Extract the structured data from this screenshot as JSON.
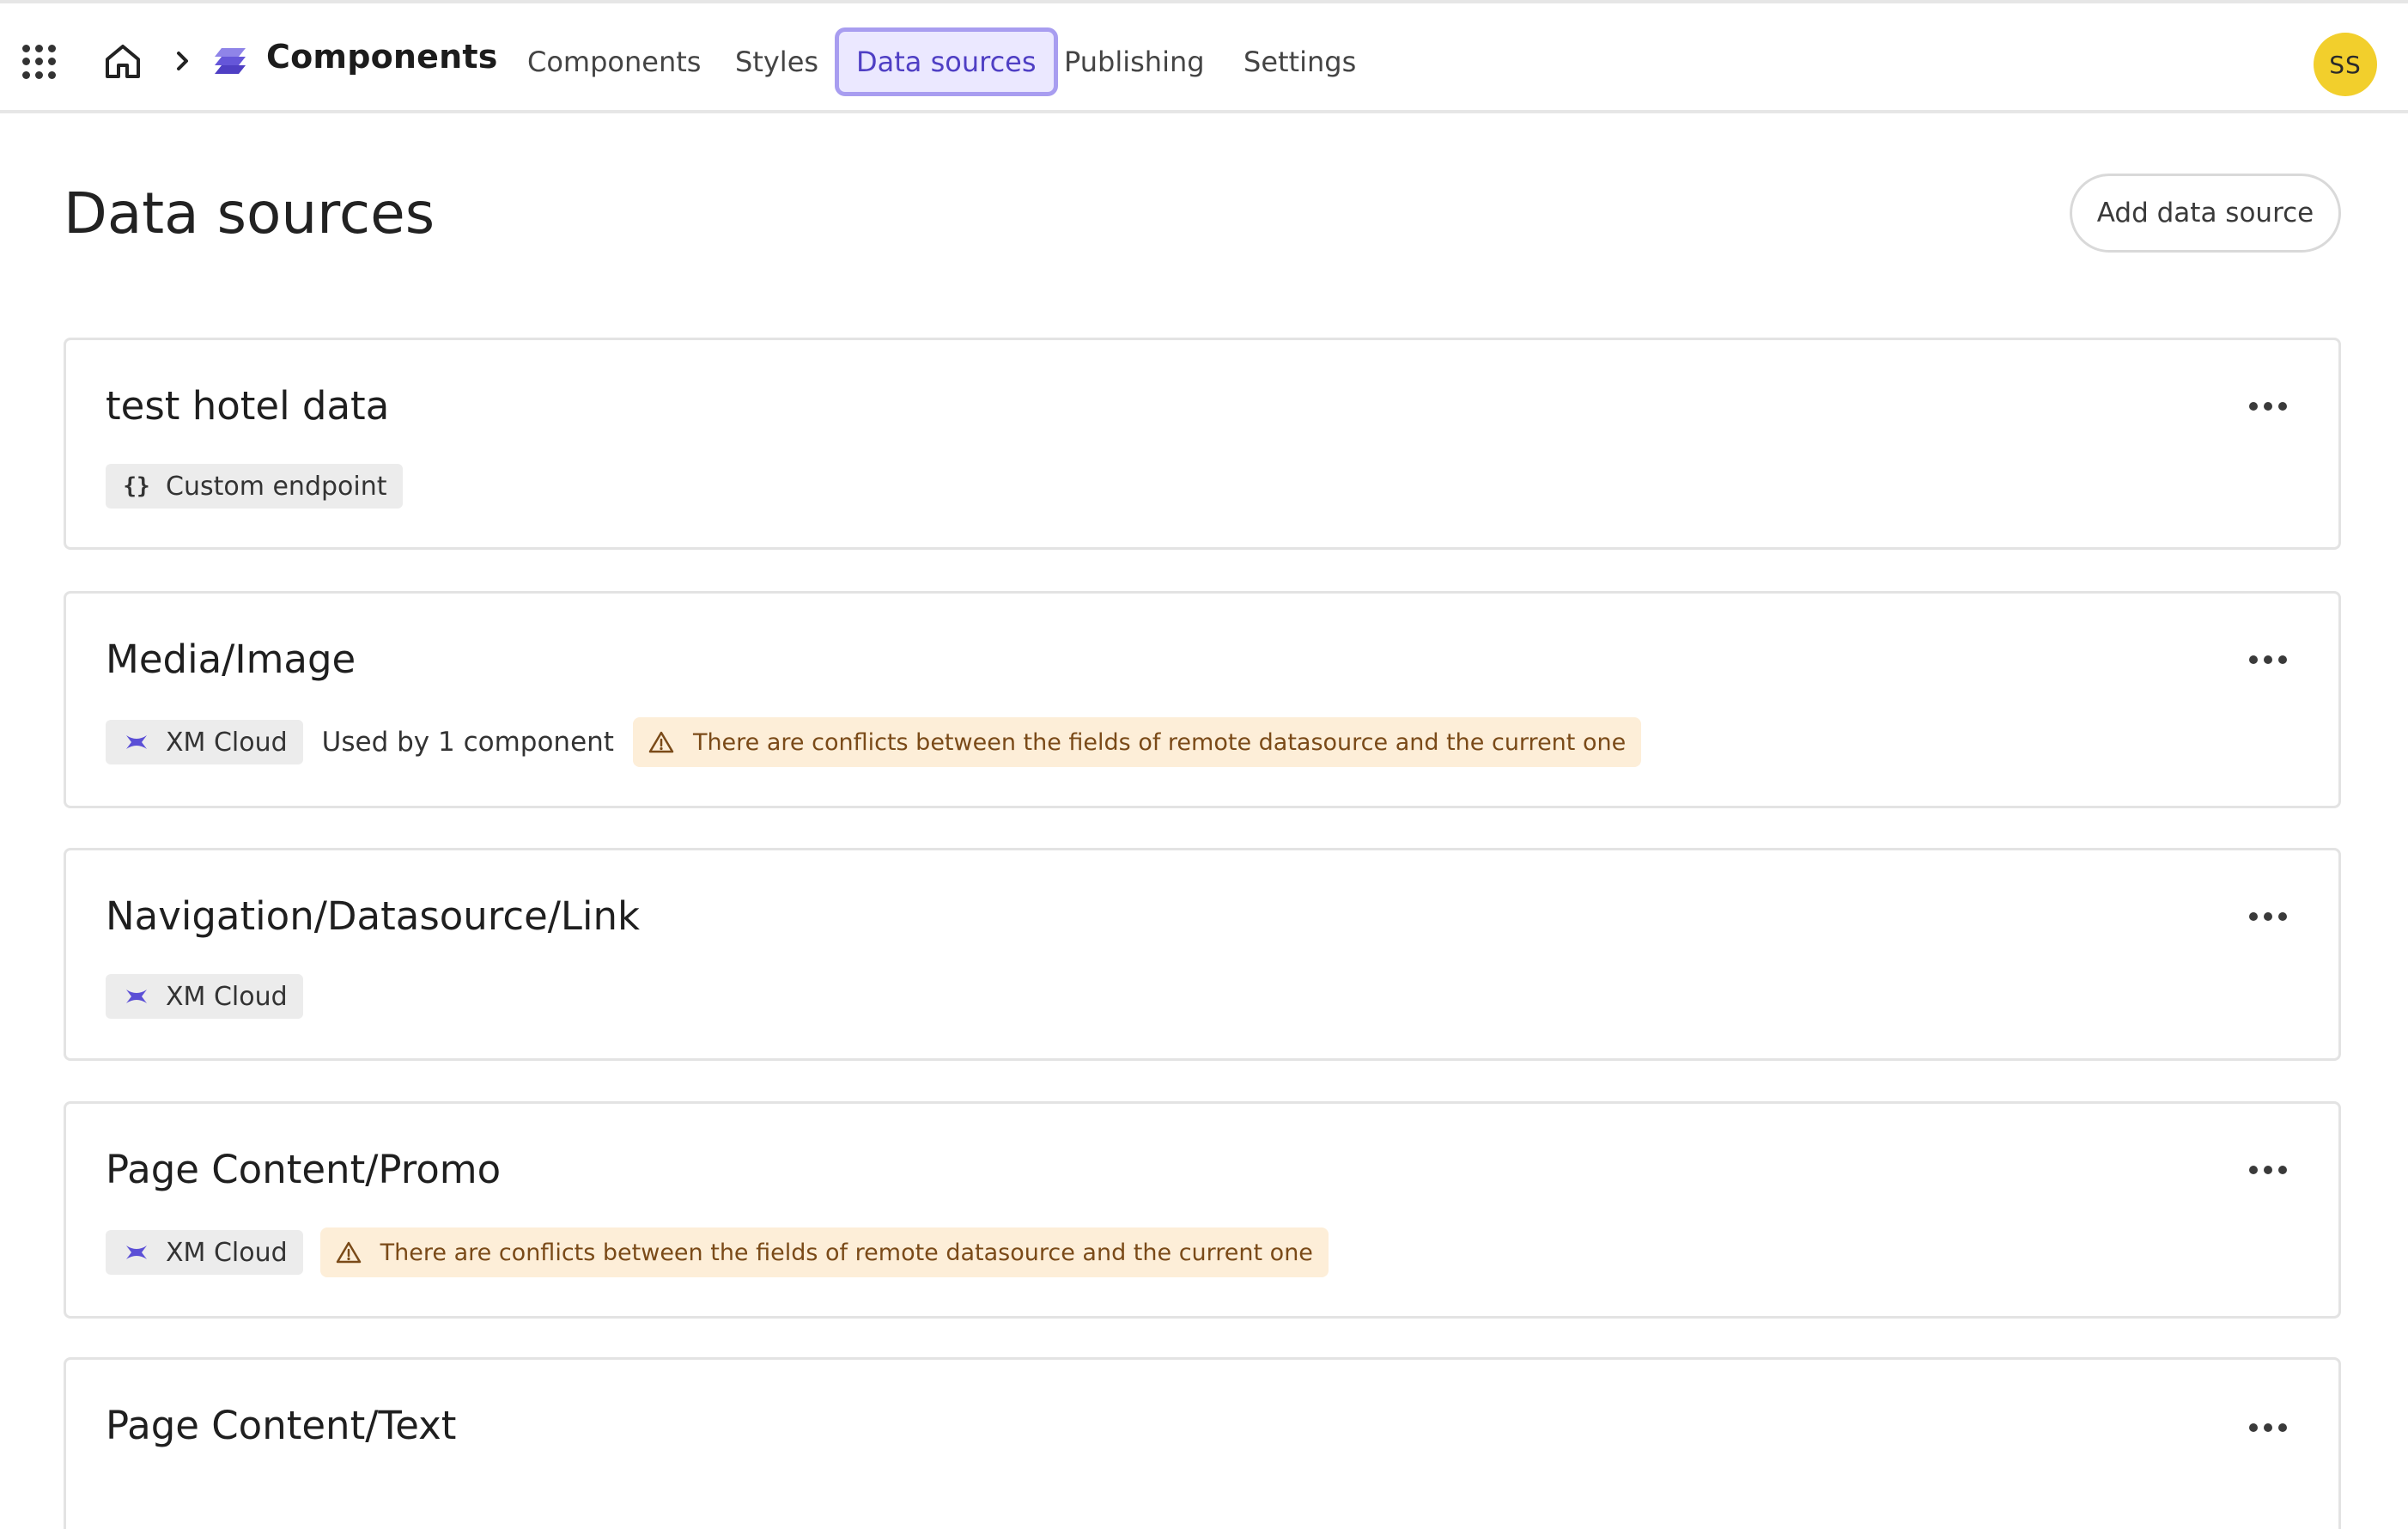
{
  "header": {
    "app_name": "Components",
    "nav": [
      {
        "label": "Components",
        "active": false
      },
      {
        "label": "Styles",
        "active": false
      },
      {
        "label": "Data sources",
        "active": true
      },
      {
        "label": "Publishing",
        "active": false
      },
      {
        "label": "Settings",
        "active": false
      }
    ],
    "user_initials": "SS",
    "icons": [
      "app-grid-icon",
      "home-icon",
      "chevron-right-icon",
      "components-logo-icon"
    ]
  },
  "page": {
    "title": "Data sources",
    "add_button_label": "Add data source"
  },
  "data_sources": [
    {
      "name": "test hotel data",
      "type_label": "Custom endpoint",
      "type_icon": "braces-icon",
      "used_by": "",
      "warning": ""
    },
    {
      "name": "Media/Image",
      "type_label": "XM Cloud",
      "type_icon": "xm-cloud-icon",
      "used_by": "Used by 1 component",
      "warning": "There are conflicts between the fields of remote datasource and the current one"
    },
    {
      "name": "Navigation/Datasource/Link",
      "type_label": "XM Cloud",
      "type_icon": "xm-cloud-icon",
      "used_by": "",
      "warning": ""
    },
    {
      "name": "Page Content/Promo",
      "type_label": "XM Cloud",
      "type_icon": "xm-cloud-icon",
      "used_by": "",
      "warning": "There are conflicts between the fields of remote datasource and the current one"
    },
    {
      "name": "Page Content/Text",
      "type_label": "",
      "type_icon": "",
      "used_by": "",
      "warning": ""
    }
  ],
  "colors": {
    "accent": "#4f3fc4",
    "active_tab_bg": "#ebe8ff",
    "warning_bg": "#fdeed8",
    "avatar_bg": "#f2cf2c"
  }
}
